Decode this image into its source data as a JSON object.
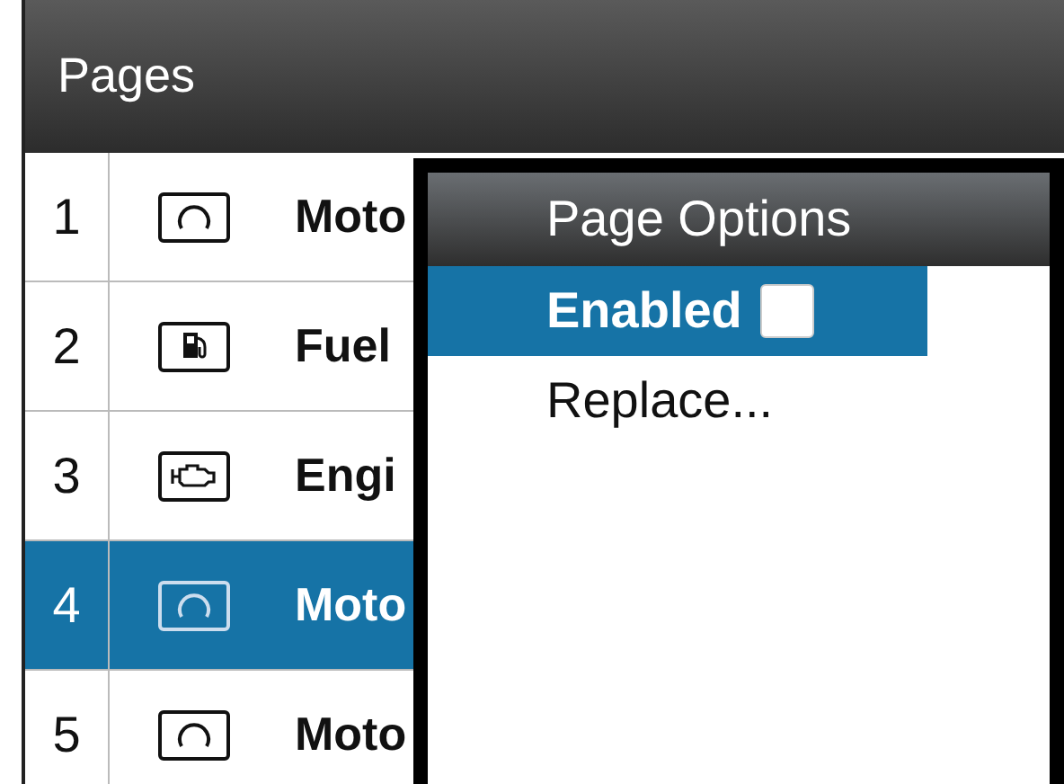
{
  "header": {
    "title": "Pages"
  },
  "pages": [
    {
      "number": "1",
      "kind": "gauge",
      "label": "Moto",
      "selected": false
    },
    {
      "number": "2",
      "kind": "fuel",
      "label": "Fuel",
      "selected": false
    },
    {
      "number": "3",
      "kind": "engine",
      "label": "Engi",
      "selected": false
    },
    {
      "number": "4",
      "kind": "gauge",
      "label": "Moto",
      "selected": true
    },
    {
      "number": "5",
      "kind": "gauge",
      "label": "Moto",
      "selected": false
    }
  ],
  "menu": {
    "title": "Page Options",
    "items": [
      {
        "kind": "checkbox",
        "label": "Enabled",
        "checked": false,
        "selected": true
      },
      {
        "kind": "action",
        "label": "Replace...",
        "selected": false
      }
    ]
  }
}
